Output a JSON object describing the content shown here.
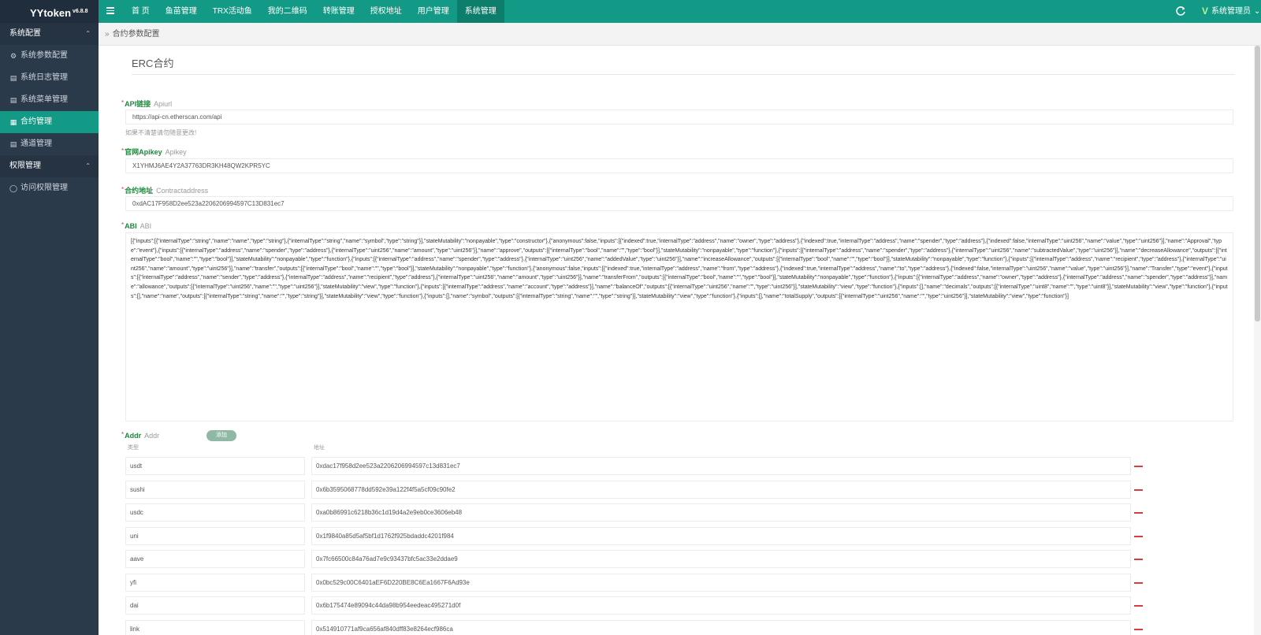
{
  "app": {
    "title": "YYtoken",
    "version": "v6.8.8"
  },
  "header": {
    "nav": [
      {
        "label": "首 页",
        "active": false
      },
      {
        "label": "鱼苗管理",
        "active": false
      },
      {
        "label": "TRX活动鱼",
        "active": false
      },
      {
        "label": "我的二维码",
        "active": false
      },
      {
        "label": "转账管理",
        "active": false
      },
      {
        "label": "授权地址",
        "active": false
      },
      {
        "label": "用户管理",
        "active": false
      },
      {
        "label": "系统管理",
        "active": true
      }
    ],
    "user_label": "系统管理员",
    "colors": {
      "primary": "#129a86",
      "dark": "#1f2d3d"
    }
  },
  "sidebar": {
    "groups": [
      {
        "label": "系统配置",
        "items": [
          {
            "label": "系统参数配置",
            "icon": "gear-icon",
            "active": false
          },
          {
            "label": "系统日志管理",
            "icon": "log-icon",
            "active": false
          },
          {
            "label": "系统菜单管理",
            "icon": "menu-icon",
            "active": false
          },
          {
            "label": "合约管理",
            "icon": "grid-icon",
            "active": true
          },
          {
            "label": "通道管理",
            "icon": "channel-icon",
            "active": false
          }
        ]
      },
      {
        "label": "权限管理",
        "items": [
          {
            "label": "访问权限管理",
            "icon": "shield-icon",
            "active": false
          }
        ]
      }
    ]
  },
  "breadcrumb": "合约参数配置",
  "form": {
    "title": "ERC合约",
    "api_url": {
      "label": "API链接",
      "sub": "Apiurl",
      "value": "https://api-cn.etherscan.com/api",
      "hint": "如果不清楚请勿随意更改!"
    },
    "api_key": {
      "label": "官网Apikey",
      "sub": "Apikey",
      "value": "X1YHMJ6AE4Y2A37763DR3KH48QW2KPR5YC"
    },
    "contract": {
      "label": "合约地址",
      "sub": "Contractaddress",
      "value": "0xdAC17F958D2ee523a2206206994597C13D831ec7"
    },
    "abi": {
      "label": "ABI",
      "sub": "ABI",
      "value": "[{\"inputs\":[{\"internalType\":\"string\",\"name\":\"name\",\"type\":\"string\"},{\"internalType\":\"string\",\"name\":\"symbol\",\"type\":\"string\"}],\"stateMutability\":\"nonpayable\",\"type\":\"constructor\"},{\"anonymous\":false,\"inputs\":[{\"indexed\":true,\"internalType\":\"address\",\"name\":\"owner\",\"type\":\"address\"},{\"indexed\":true,\"internalType\":\"address\",\"name\":\"spender\",\"type\":\"address\"},{\"indexed\":false,\"internalType\":\"uint256\",\"name\":\"value\",\"type\":\"uint256\"}],\"name\":\"Approval\",\"type\":\"event\"},{\"inputs\":[{\"internalType\":\"address\",\"name\":\"spender\",\"type\":\"address\"},{\"internalType\":\"uint256\",\"name\":\"amount\",\"type\":\"uint256\"}],\"name\":\"approve\",\"outputs\":[{\"internalType\":\"bool\",\"name\":\"\",\"type\":\"bool\"}],\"stateMutability\":\"nonpayable\",\"type\":\"function\"},{\"inputs\":[{\"internalType\":\"address\",\"name\":\"spender\",\"type\":\"address\"},{\"internalType\":\"uint256\",\"name\":\"subtractedValue\",\"type\":\"uint256\"}],\"name\":\"decreaseAllowance\",\"outputs\":[{\"internalType\":\"bool\",\"name\":\"\",\"type\":\"bool\"}],\"stateMutability\":\"nonpayable\",\"type\":\"function\"},{\"inputs\":[{\"internalType\":\"address\",\"name\":\"spender\",\"type\":\"address\"},{\"internalType\":\"uint256\",\"name\":\"addedValue\",\"type\":\"uint256\"}],\"name\":\"increaseAllowance\",\"outputs\":[{\"internalType\":\"bool\",\"name\":\"\",\"type\":\"bool\"}],\"stateMutability\":\"nonpayable\",\"type\":\"function\"},{\"inputs\":[{\"internalType\":\"address\",\"name\":\"recipient\",\"type\":\"address\"},{\"internalType\":\"uint256\",\"name\":\"amount\",\"type\":\"uint256\"}],\"name\":\"transfer\",\"outputs\":[{\"internalType\":\"bool\",\"name\":\"\",\"type\":\"bool\"}],\"stateMutability\":\"nonpayable\",\"type\":\"function\"},{\"anonymous\":false,\"inputs\":[{\"indexed\":true,\"internalType\":\"address\",\"name\":\"from\",\"type\":\"address\"},{\"indexed\":true,\"internalType\":\"address\",\"name\":\"to\",\"type\":\"address\"},{\"indexed\":false,\"internalType\":\"uint256\",\"name\":\"value\",\"type\":\"uint256\"}],\"name\":\"Transfer\",\"type\":\"event\"},{\"inputs\":[{\"internalType\":\"address\",\"name\":\"sender\",\"type\":\"address\"},{\"internalType\":\"address\",\"name\":\"recipient\",\"type\":\"address\"},{\"internalType\":\"uint256\",\"name\":\"amount\",\"type\":\"uint256\"}],\"name\":\"transferFrom\",\"outputs\":[{\"internalType\":\"bool\",\"name\":\"\",\"type\":\"bool\"}],\"stateMutability\":\"nonpayable\",\"type\":\"function\"},{\"inputs\":[{\"internalType\":\"address\",\"name\":\"owner\",\"type\":\"address\"},{\"internalType\":\"address\",\"name\":\"spender\",\"type\":\"address\"}],\"name\":\"allowance\",\"outputs\":[{\"internalType\":\"uint256\",\"name\":\"\",\"type\":\"uint256\"}],\"stateMutability\":\"view\",\"type\":\"function\"},{\"inputs\":[{\"internalType\":\"address\",\"name\":\"account\",\"type\":\"address\"}],\"name\":\"balanceOf\",\"outputs\":[{\"internalType\":\"uint256\",\"name\":\"\",\"type\":\"uint256\"}],\"stateMutability\":\"view\",\"type\":\"function\"},{\"inputs\":[],\"name\":\"decimals\",\"outputs\":[{\"internalType\":\"uint8\",\"name\":\"\",\"type\":\"uint8\"}],\"stateMutability\":\"view\",\"type\":\"function\"},{\"inputs\":[],\"name\":\"name\",\"outputs\":[{\"internalType\":\"string\",\"name\":\"\",\"type\":\"string\"}],\"stateMutability\":\"view\",\"type\":\"function\"},{\"inputs\":[],\"name\":\"symbol\",\"outputs\":[{\"internalType\":\"string\",\"name\":\"\",\"type\":\"string\"}],\"stateMutability\":\"view\",\"type\":\"function\"},{\"inputs\":[],\"name\":\"totalSupply\",\"outputs\":[{\"internalType\":\"uint256\",\"name\":\"\",\"type\":\"uint256\"}],\"stateMutability\":\"view\",\"type\":\"function\"}]"
    },
    "addr": {
      "label": "Addr",
      "sub": "Addr",
      "add_button": "添加",
      "col_type": "类型",
      "col_addr": "地址",
      "rows": [
        {
          "type": "usdt",
          "addr": "0xdac17f958d2ee523a2206206994597c13d831ec7"
        },
        {
          "type": "sushi",
          "addr": "0x6b3595068778dd592e39a122f4f5a5cf09c90fe2"
        },
        {
          "type": "usdc",
          "addr": "0xa0b86991c6218b36c1d19d4a2e9eb0ce3606eb48"
        },
        {
          "type": "uni",
          "addr": "0x1f9840a85d5af5bf1d1762f925bdaddc4201f984"
        },
        {
          "type": "aave",
          "addr": "0x7fc66500c84a76ad7e9c93437bfc5ac33e2ddae9"
        },
        {
          "type": "yfi",
          "addr": "0x0bc529c00C6401aEF6D220BE8C6Ea1667F6Ad93e"
        },
        {
          "type": "dai",
          "addr": "0x6b175474e89094c44da98b954eedeac495271d0f"
        },
        {
          "type": "link",
          "addr": "0x514910771af9ca656af840dff83e8264ecf986ca"
        }
      ]
    }
  }
}
